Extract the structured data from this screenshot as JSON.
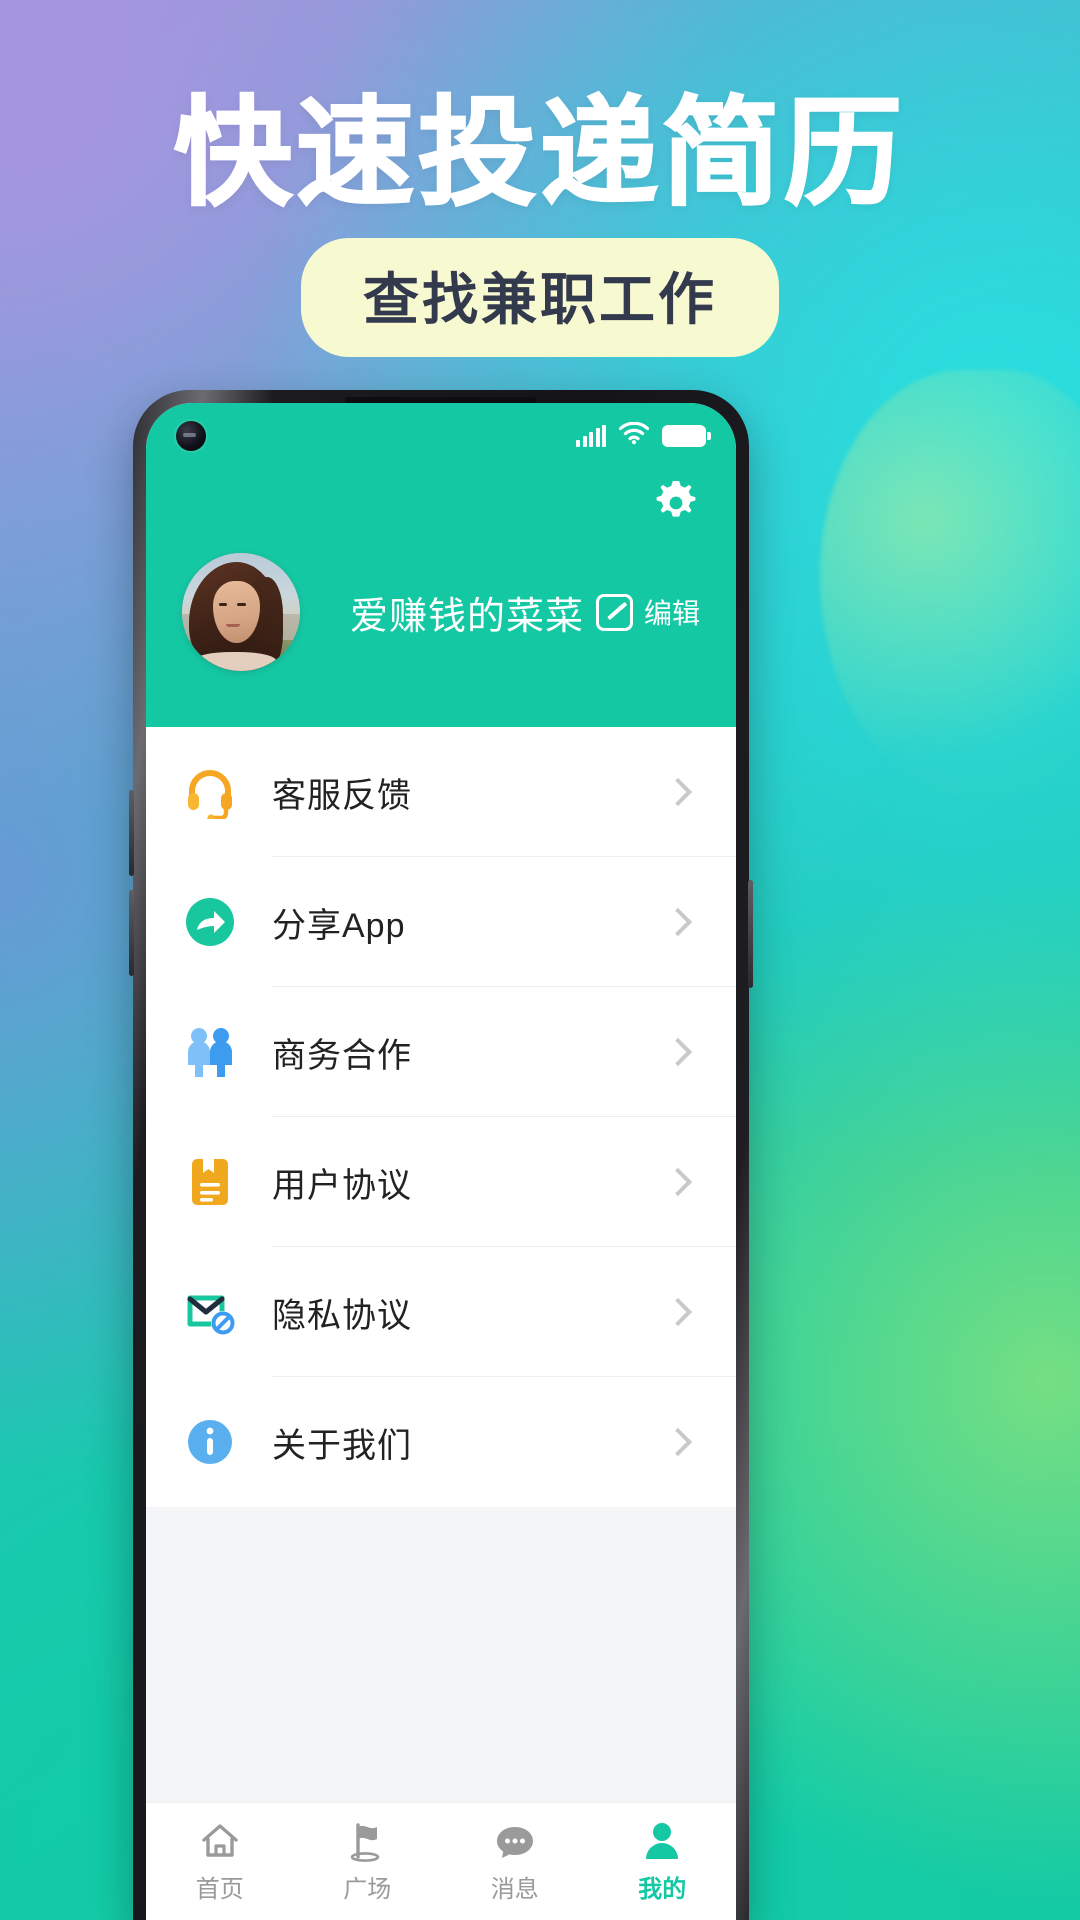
{
  "poster": {
    "headline": "快速投递简历",
    "subtitle": "查找兼职工作",
    "colors": {
      "brand_green": "#15c8a4",
      "pill_bg": "#f7f9d0",
      "pill_text": "#333a4d"
    }
  },
  "phone": {
    "statusbar": {
      "signal_icon": "cellular-signal-icon",
      "wifi_icon": "wifi-icon",
      "battery_icon": "battery-full-icon",
      "camera": "punch-hole-camera"
    },
    "header": {
      "settings_icon": "gear-icon",
      "username": "爱赚钱的菜菜",
      "edit_label": "编辑",
      "edit_icon": "pencil-edit-icon",
      "avatar_icon": "user-avatar-photo"
    },
    "menu": [
      {
        "label": "客服反馈",
        "icon": "headset-support-icon",
        "color": "#f5a623"
      },
      {
        "label": "分享App",
        "icon": "share-arrow-icon",
        "color": "#19c79e"
      },
      {
        "label": "商务合作",
        "icon": "two-people-icon",
        "color": "#3d9bf0"
      },
      {
        "label": "用户协议",
        "icon": "document-agreement-icon",
        "color": "#f0a81e"
      },
      {
        "label": "隐私协议",
        "icon": "privacy-shield-mail-icon",
        "color": "#19c79e"
      },
      {
        "label": "关于我们",
        "icon": "info-circle-icon",
        "color": "#3d9bf0"
      }
    ],
    "chevron_icon": "chevron-right-icon",
    "tabs": [
      {
        "label": "首页",
        "icon": "home-icon",
        "active": false
      },
      {
        "label": "广场",
        "icon": "plaza-flag-icon",
        "active": false
      },
      {
        "label": "消息",
        "icon": "message-bubble-icon",
        "active": false
      },
      {
        "label": "我的",
        "icon": "person-icon",
        "active": true
      }
    ]
  }
}
